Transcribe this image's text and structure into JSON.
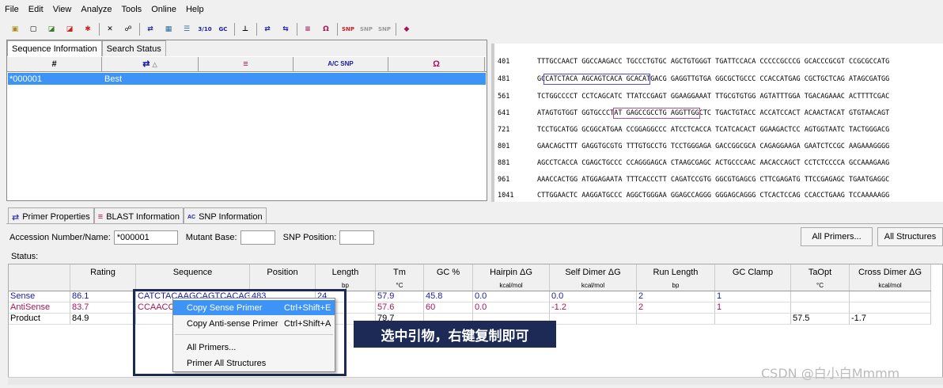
{
  "menu": [
    "File",
    "Edit",
    "View",
    "Analyze",
    "Tools",
    "Online",
    "Help"
  ],
  "toolbar_icons": [
    "new-folder-icon",
    "new-file-icon",
    "open-icon",
    "open-gb-icon",
    "snp-icon",
    "close-icon",
    "binoculars-icon",
    "swap-arrows-icon",
    "chart-icon",
    "list-icon",
    "3-10-icon",
    "gc-icon",
    "tree-icon",
    "forward-reverse-icon",
    "primer-pair-icon",
    "lines-icon",
    "omega-icon",
    "snp2-icon",
    "snp-cross-icon",
    "snp-check-icon",
    "diamond-icon"
  ],
  "top_tabs": [
    "Sequence Information",
    "Search Status"
  ],
  "top_columns": [
    "#",
    "",
    "",
    "",
    ""
  ],
  "top_row": {
    "id": "*000001",
    "status": "Best"
  },
  "sequence": [
    {
      "num": "401",
      "text": "TTTGCCAACT GGCCAAGACC TGCCCTGTGC AGCTGTGGGT TGATTCCACA CCCCCGCCCG GCACCCGCGT CCGCGCCATG"
    },
    {
      "num": "481",
      "text": "GCCATCTACA AGCAGTCACA GCACATGACG GAGGTTGTGA GGCGCTGCCC CCACCATGAG CGCTGCTCAG ATAGCGATGG"
    },
    {
      "num": "561",
      "text": "TCTGGCCCCT CCTCAGCATC TTATCCGAGT GGAAGGAAAT TTGCGTGTGG AGTATTTGGA TGACAGAAAC ACTTTTCGAC"
    },
    {
      "num": "641",
      "text": "ATAGTGTGGT GGTGCCCTAT GAGCCGCCTG AGGTTGGCTC TGACTGTACC ACCATCCACT ACAACTACAT GTGTAACAGT"
    },
    {
      "num": "721",
      "text": "TCCTGCATGG GCGGCATGAA CCGGAGGCCC ATCCTCACCA TCATCACACT GGAAGACTCC AGTGGTAATC TACTGGGACG"
    },
    {
      "num": "801",
      "text": "GAACAGCTTT GAGGTGCGTG TTTGTGCCTG TCCTGGGAGA GACCGGCGCA CAGAGGAAGA GAATCTCCGC AAGAAAGGGG"
    },
    {
      "num": "881",
      "text": "AGCCTCACCA CGAGCTGCCC CCAGGGAGCA CTAAGCGAGC ACTGCCCAAC AACACCAGCT CCTCTCCCCA GCCAAAGAAG"
    },
    {
      "num": "961",
      "text": "AAACCACTGG ATGGAGAATA TTTCACCCTT CAGATCCGTG GGCGTGAGCG CTTCGAGATG TTCCGAGAGC TGAATGAGGC"
    },
    {
      "num": "1041",
      "text": "CTTGGAACTC AAGGATGCCC AGGCTGGGAA GGAGCCAGGG GGGAGCAGGG CTCACTCCAG CCACCTGAAG TCCAAAAAGG"
    }
  ],
  "bottom_tabs": [
    "Primer Properties",
    "BLAST Information",
    "SNP Information"
  ],
  "accession_label": "Accession Number/Name:",
  "accession_value": "*000001",
  "mutant_label": "Mutant Base:",
  "snp_label": "SNP Position:",
  "btn_all_primers": "All Primers...",
  "btn_all_structures": "All Structures",
  "status_label": "Status:",
  "grid_columns": [
    {
      "name": "",
      "unit": ""
    },
    {
      "name": "Rating",
      "unit": ""
    },
    {
      "name": "Sequence",
      "unit": ""
    },
    {
      "name": "Position",
      "unit": ""
    },
    {
      "name": "Length",
      "unit": "bp"
    },
    {
      "name": "Tm",
      "unit": "°C"
    },
    {
      "name": "GC %",
      "unit": ""
    },
    {
      "name": "Hairpin ΔG",
      "unit": "kcal/mol"
    },
    {
      "name": "Self Dimer ΔG",
      "unit": "kcal/mol"
    },
    {
      "name": "Run Length",
      "unit": "bp"
    },
    {
      "name": "GC Clamp",
      "unit": ""
    },
    {
      "name": "TaOpt",
      "unit": "°C"
    },
    {
      "name": "Cross Dimer ΔG",
      "unit": "kcal/mol"
    }
  ],
  "grid_rows": [
    {
      "label": "Sense",
      "color": "#1a1aa6",
      "cells": [
        "86.1",
        "CATCTACAAGCAGTCACAG",
        "483",
        "24",
        "57.9",
        "45.8",
        "0.0",
        "0.0",
        "2",
        "1",
        "",
        ""
      ]
    },
    {
      "label": "AntiSense",
      "color": "#a6145a",
      "cells": [
        "83.7",
        "CCAACC",
        "",
        "",
        "57.6",
        "60",
        "0.0",
        "-1.2",
        "2",
        "1",
        "",
        ""
      ]
    },
    {
      "label": "Product",
      "color": "#000000",
      "cells": [
        "84.9",
        "",
        "",
        "",
        "79.7",
        "",
        "",
        "",
        "",
        "",
        "57.5",
        "-1.7"
      ]
    }
  ],
  "context_menu": [
    {
      "label": "Copy Sense Primer",
      "key": "Ctrl+Shift+E"
    },
    {
      "label": "Copy Anti-sense Primer",
      "key": "Ctrl+Shift+A"
    },
    {
      "label": "All Primers...",
      "key": ""
    },
    {
      "label": "Primer All Structures",
      "key": ""
    }
  ],
  "callout": "选中引物，右键复制即可",
  "watermark": "CSDN @白小白Mmmm"
}
